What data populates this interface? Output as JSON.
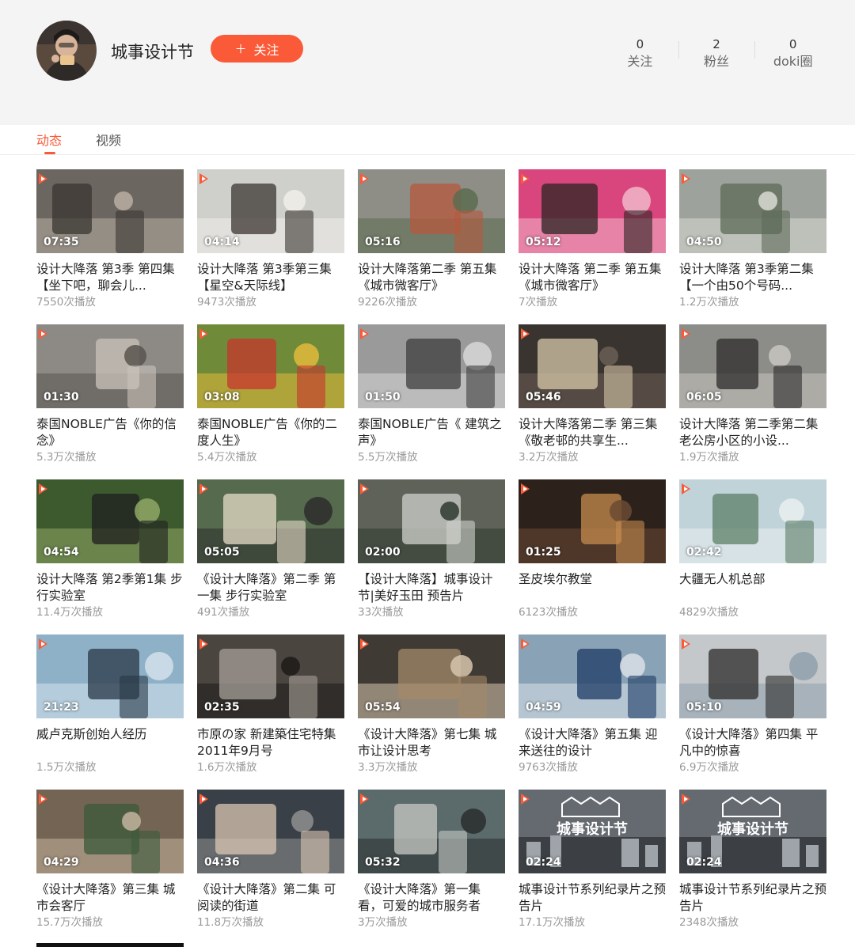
{
  "profile": {
    "name": "城事设计节",
    "follow_label": "关注",
    "stats": [
      {
        "num": "0",
        "label": "关注"
      },
      {
        "num": "2",
        "label": "粉丝"
      },
      {
        "num": "0",
        "label": "doki圈"
      }
    ]
  },
  "tabs": [
    {
      "label": "动态",
      "active": true
    },
    {
      "label": "视频",
      "active": false
    }
  ],
  "videos": [
    {
      "duration": "07:35",
      "title": "设计大降落 第3季 第四集【坐下吧，聊会儿...",
      "plays": "7550次播放",
      "theme": "street"
    },
    {
      "duration": "04:14",
      "title": "设计大降落 第3季第三集【星空&天际线】",
      "plays": "9473次播放",
      "theme": "man"
    },
    {
      "duration": "05:16",
      "title": "设计大降落第二季 第五集《城市微客厅》",
      "plays": "9226次播放",
      "theme": "aerial"
    },
    {
      "duration": "05:12",
      "title": "设计大降落 第二季 第五集《城市微客厅》",
      "plays": "7次播放",
      "theme": "pink"
    },
    {
      "duration": "04:50",
      "title": "设计大降落 第3季第二集【一个由50个号码...",
      "plays": "1.2万次播放",
      "theme": "aerial2"
    },
    {
      "duration": "01:30",
      "title": "泰国NOBLE广告《你的信念》",
      "plays": "5.3万次播放",
      "theme": "studio"
    },
    {
      "duration": "03:08",
      "title": "泰国NOBLE广告《你的二度人生》",
      "plays": "5.4万次播放",
      "theme": "market"
    },
    {
      "duration": "01:50",
      "title": "泰国NOBLE广告《 建筑之声》",
      "plays": "5.5万次播放",
      "theme": "tower"
    },
    {
      "duration": "05:46",
      "title": "设计大降落第二季 第三集 《敬老邨的共享生...",
      "plays": "3.2万次播放",
      "theme": "elder"
    },
    {
      "duration": "06:05",
      "title": "设计大降落 第二季第二集 老公房小区的小设...",
      "plays": "1.9万次播放",
      "theme": "portrait"
    },
    {
      "duration": "04:54",
      "title": "设计大降落 第2季第1集 步行实验室",
      "plays": "11.4万次播放",
      "theme": "park"
    },
    {
      "duration": "05:05",
      "title": "《设计大降落》第二季 第一集 步行实验室",
      "plays": "491次播放",
      "theme": "couple"
    },
    {
      "duration": "02:00",
      "title": "【设计大降落】城事设计节|美好玉田 预告片",
      "plays": "33次播放",
      "theme": "aerial3"
    },
    {
      "duration": "01:25",
      "title": "圣皮埃尔教堂",
      "plays": "6123次播放",
      "theme": "church"
    },
    {
      "duration": "02:42",
      "title": "大疆无人机总部",
      "plays": "4829次播放",
      "theme": "render"
    },
    {
      "duration": "21:23",
      "title": "威卢克斯创始人经历",
      "plays": "1.5万次播放",
      "theme": "silhouette"
    },
    {
      "duration": "02:35",
      "title": "市原の家 新建築住宅特集2011年9月号",
      "plays": "1.6万次播放",
      "theme": "interior"
    },
    {
      "duration": "05:54",
      "title": "《设计大降落》第七集 城市让设计思考",
      "plays": "3.3万次播放",
      "theme": "shelf"
    },
    {
      "duration": "04:59",
      "title": "《设计大降落》第五集 迎来送往的设计",
      "plays": "9763次播放",
      "theme": "child"
    },
    {
      "duration": "05:10",
      "title": "《设计大降落》第四集 平凡中的惊喜",
      "plays": "6.9万次播放",
      "theme": "stairs"
    },
    {
      "duration": "04:29",
      "title": "《设计大降落》第三集 城市会客厅",
      "plays": "15.7万次播放",
      "theme": "garden"
    },
    {
      "duration": "04:36",
      "title": "《设计大降落》第二集 可阅读的街道",
      "plays": "11.8万次播放",
      "theme": "family"
    },
    {
      "duration": "05:32",
      "title": "《设计大降落》第一集 看，可爱的城市服务者",
      "plays": "3万次播放",
      "theme": "bus"
    },
    {
      "duration": "02:24",
      "title": "城事设计节系列纪录片之预告片",
      "plays": "17.1万次播放",
      "theme": "logo"
    },
    {
      "duration": "02:24",
      "title": "城事设计节系列纪录片之预告片",
      "plays": "2348次播放",
      "theme": "logo"
    }
  ],
  "colors": {
    "accent": "#fa5a38",
    "header_bg": "#f4f4f4"
  }
}
